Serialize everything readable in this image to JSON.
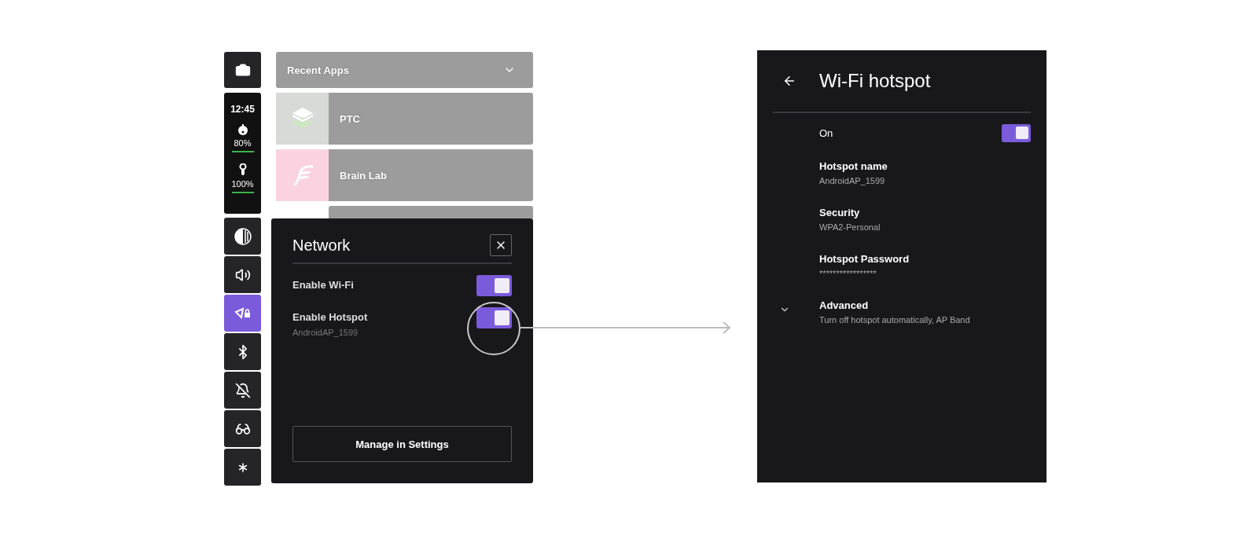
{
  "status": {
    "time": "12:45",
    "devices": [
      {
        "kind": "headset",
        "reading": "80%"
      },
      {
        "kind": "controller",
        "reading": "100%"
      }
    ]
  },
  "sidebar": {
    "tiles": [
      {
        "kind": "contrast",
        "selected": false
      },
      {
        "kind": "volume",
        "selected": false
      },
      {
        "kind": "network",
        "selected": true
      },
      {
        "kind": "bluetooth",
        "selected": false
      },
      {
        "kind": "mute",
        "selected": false
      },
      {
        "kind": "glasses",
        "selected": false
      },
      {
        "kind": "spark",
        "selected": false
      }
    ]
  },
  "recent_apps": {
    "title": "Recent Apps",
    "apps": [
      {
        "kind": "ptc",
        "name": "PTC"
      },
      {
        "kind": "brainlab",
        "name": "Brain Lab"
      }
    ]
  },
  "network_panel": {
    "title": "Network",
    "toggles": [
      {
        "label": "Enable Wi-Fi",
        "on": true
      },
      {
        "label": "Enable Hotspot",
        "subtitle": "AndroidAP_1599",
        "on": true
      }
    ],
    "button": "Manage in Settings"
  },
  "hotspot_screen": {
    "title": "Wi-Fi hotspot",
    "switch": {
      "label": "On",
      "on": true
    },
    "items": [
      {
        "title": "Hotspot name",
        "subtitle": "AndroidAP_1599"
      },
      {
        "title": "Security",
        "subtitle": "WPA2-Personal"
      },
      {
        "title": "Hotspot Password",
        "subtitle": "*****************"
      }
    ],
    "advanced": {
      "title": "Advanced",
      "subtitle": "Turn off hotspot automatically, AP Band",
      "expanded": false
    }
  }
}
